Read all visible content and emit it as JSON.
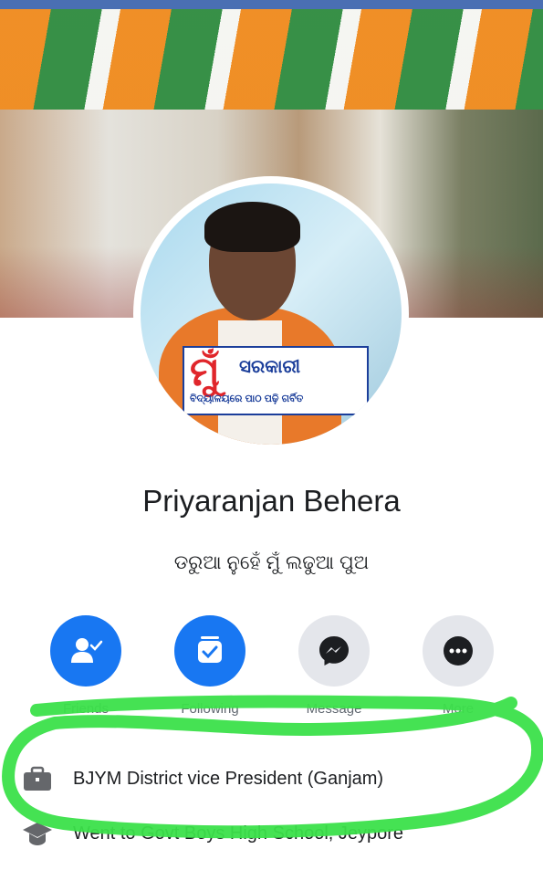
{
  "profile": {
    "name": "Priyaranjan Behera",
    "bio": "ଡରୁଆ ନୁହେଁ ମୁଁ ଲଢୁଆ ପୁଅ"
  },
  "cover_photo": {
    "badge_mark": "ମୁଁ",
    "badge_title": "ସରକାରୀ",
    "badge_subtitle": "ବିଦ୍ୟାଳୟରେ ପାଠ ପଢ଼ି ଗର୍ବିତ"
  },
  "actions": [
    {
      "label": "Friends",
      "icon": "friend-check-icon"
    },
    {
      "label": "Following",
      "icon": "following-check-icon"
    },
    {
      "label": "Message",
      "icon": "messenger-icon"
    },
    {
      "label": "More",
      "icon": "more-dots-icon"
    }
  ],
  "intro": {
    "work": "BJYM District vice President  (Ganjam)",
    "education": "Went to Govt Boys High School, Jeypore"
  },
  "colors": {
    "accent": "#1877f2",
    "gray_button": "#e4e6eb",
    "highlight": "#3be04a"
  }
}
